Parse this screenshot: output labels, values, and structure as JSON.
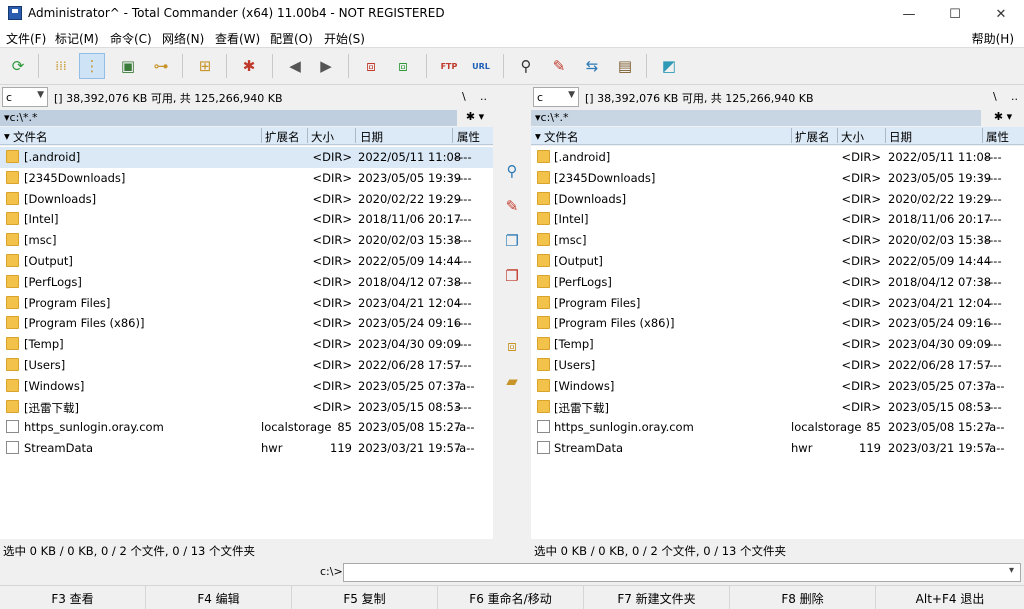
{
  "window": {
    "title": "Administrator^ - Total Commander (x64) 11.00b4 - NOT REGISTERED",
    "minimize": "—",
    "maximize": "☐",
    "close": "✕"
  },
  "menu": [
    "文件(F)",
    "标记(M)",
    "命令(C)",
    "网络(N)",
    "查看(W)",
    "配置(O)",
    "开始(S)"
  ],
  "help_menu": "帮助(H)",
  "toolbar_icons": [
    "refresh-icon",
    "brief-view-icon",
    "detailed-view-icon",
    "thumbnails-view-icon",
    "tree-view-icon",
    "compare-dirs-icon",
    "select-files-icon",
    "back-icon",
    "forward-icon",
    "pack-icon",
    "unpack-icon",
    "ftp-icon",
    "url-icon",
    "search-icon",
    "multi-rename-icon",
    "sync-dirs-icon",
    "notepad-icon",
    "paste-icon"
  ],
  "toolbar_labels": {
    "ftp": "FTP",
    "url": "URL"
  },
  "left": {
    "drive": "c",
    "drive_info": "[]  38,392,076 KB 可用, 共 125,266,940 KB",
    "root": "\\",
    "up": "..",
    "path": "c:\\*.*",
    "status": "选中 0 KB / 0 KB, 0 / 2 个文件, 0 / 13 个文件夹"
  },
  "right": {
    "drive": "c",
    "drive_info": "[]  38,392,076 KB 可用, 共 125,266,940 KB",
    "root": "\\",
    "up": "..",
    "path": "c:\\*.*",
    "status": "选中 0 KB / 0 KB, 0 / 2 个文件, 0 / 13 个文件夹"
  },
  "columns": {
    "name": "文件名",
    "ext": "扩展名",
    "size": "大小",
    "date": "日期",
    "attr": "属性"
  },
  "files": [
    {
      "name": "[.android]",
      "ext": "",
      "size": "<DIR>",
      "date": "2022/05/11 11:08",
      "attr": "----",
      "type": "folder"
    },
    {
      "name": "[2345Downloads]",
      "ext": "",
      "size": "<DIR>",
      "date": "2023/05/05 19:39",
      "attr": "----",
      "type": "folder"
    },
    {
      "name": "[Downloads]",
      "ext": "",
      "size": "<DIR>",
      "date": "2020/02/22 19:29",
      "attr": "----",
      "type": "folder"
    },
    {
      "name": "[Intel]",
      "ext": "",
      "size": "<DIR>",
      "date": "2018/11/06 20:17",
      "attr": "----",
      "type": "folder"
    },
    {
      "name": "[msc]",
      "ext": "",
      "size": "<DIR>",
      "date": "2020/02/03 15:38",
      "attr": "----",
      "type": "folder"
    },
    {
      "name": "[Output]",
      "ext": "",
      "size": "<DIR>",
      "date": "2022/05/09 14:44",
      "attr": "----",
      "type": "folder"
    },
    {
      "name": "[PerfLogs]",
      "ext": "",
      "size": "<DIR>",
      "date": "2018/04/12 07:38",
      "attr": "----",
      "type": "folder"
    },
    {
      "name": "[Program Files]",
      "ext": "",
      "size": "<DIR>",
      "date": "2023/04/21 12:04",
      "attr": "----",
      "type": "folder"
    },
    {
      "name": "[Program Files (x86)]",
      "ext": "",
      "size": "<DIR>",
      "date": "2023/05/24 09:16",
      "attr": "----",
      "type": "folder"
    },
    {
      "name": "[Temp]",
      "ext": "",
      "size": "<DIR>",
      "date": "2023/04/30 09:09",
      "attr": "----",
      "type": "folder"
    },
    {
      "name": "[Users]",
      "ext": "",
      "size": "<DIR>",
      "date": "2022/06/28 17:57",
      "attr": "----",
      "type": "folder"
    },
    {
      "name": "[Windows]",
      "ext": "",
      "size": "<DIR>",
      "date": "2023/05/25 07:37",
      "attr": "-a--",
      "type": "folder"
    },
    {
      "name": "[迅雷下载]",
      "ext": "",
      "size": "<DIR>",
      "date": "2023/05/15 08:53",
      "attr": "----",
      "type": "folder"
    },
    {
      "name": "https_sunlogin.oray.com",
      "ext": "localstorage",
      "size": "85",
      "date": "2023/05/08 15:27",
      "attr": "-a--",
      "type": "file"
    },
    {
      "name": "StreamData",
      "ext": "hwr",
      "size": "119",
      "date": "2023/03/21 19:57",
      "attr": "-a--",
      "type": "file"
    }
  ],
  "middle_icons": [
    "view-file-icon",
    "edit-file-icon",
    "copy-files-icon",
    "move-files-icon",
    "pack-files-icon",
    "new-folder-icon"
  ],
  "command": {
    "label": "c:\\>",
    "value": ""
  },
  "fkeys": [
    "F3 查看",
    "F4 编辑",
    "F5 复制",
    "F6 重命名/移动",
    "F7 新建文件夹",
    "F8 删除",
    "Alt+F4 退出"
  ]
}
